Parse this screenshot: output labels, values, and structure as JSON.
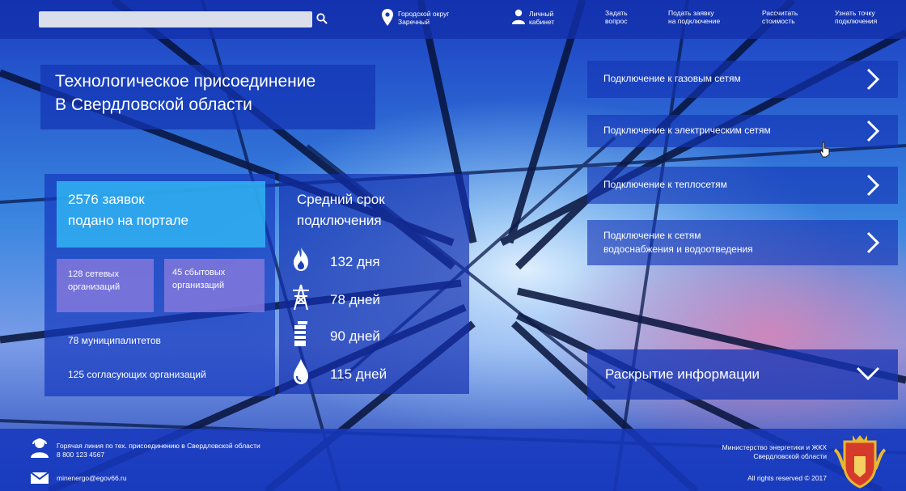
{
  "search": {
    "placeholder": ""
  },
  "top_nav": {
    "location": [
      "Городской округ",
      "Заречный"
    ],
    "account": [
      "Личный",
      "кабинет"
    ],
    "ask": [
      "Задать",
      "вопрос"
    ],
    "apply": [
      "Подать заявку",
      "на подключение"
    ],
    "calculate": [
      "Рассчитать",
      "стоимость"
    ],
    "find_point": [
      "Узнать точку",
      "подключения"
    ]
  },
  "hero": {
    "title": [
      "Технологическое присоединение",
      "В Свердловской области"
    ]
  },
  "stats": {
    "applications": [
      "2576 заявок",
      "подано на портале"
    ],
    "network_orgs": [
      "128 сетевых",
      "организаций"
    ],
    "sales_orgs": [
      "45 сбытовых",
      "организаций"
    ],
    "municipalities": "78 муниципалитетов",
    "approving_orgs": "125 согласующих организаций"
  },
  "avg_term": {
    "title": [
      "Средний срок",
      "подключения"
    ],
    "items": [
      {
        "icon": "gas-flame-icon",
        "value": "132 дня"
      },
      {
        "icon": "power-tower-icon",
        "value": "78 дней"
      },
      {
        "icon": "heat-radiator-icon",
        "value": "90 дней"
      },
      {
        "icon": "water-drop-icon",
        "value": "115 дней"
      }
    ]
  },
  "services": [
    {
      "lines": [
        "Подключение к газовым сетям"
      ]
    },
    {
      "lines": [
        "Подключение к электрическим сетям"
      ]
    },
    {
      "lines": [
        "Подключение к теплосетям"
      ]
    },
    {
      "lines": [
        "Подключение к сетям",
        "водоснабжения и водоотведения"
      ]
    }
  ],
  "disclosure": {
    "label": "Раскрытие информации"
  },
  "footer": {
    "hotline": "Горячая линия по тех. присоединению в Свердловской области",
    "phone": "8 800 123 4567",
    "email": "minenergo@egov66.ru",
    "ministry": [
      "Министерство энергетики и ЖКХ",
      "Свердловской области"
    ],
    "rights": "All rights reserved © 2017"
  },
  "colors": {
    "panel_blue": "#1434b4",
    "light_blue": "#30b0f0",
    "violet": "#8278dc",
    "text": "#ffffff"
  }
}
